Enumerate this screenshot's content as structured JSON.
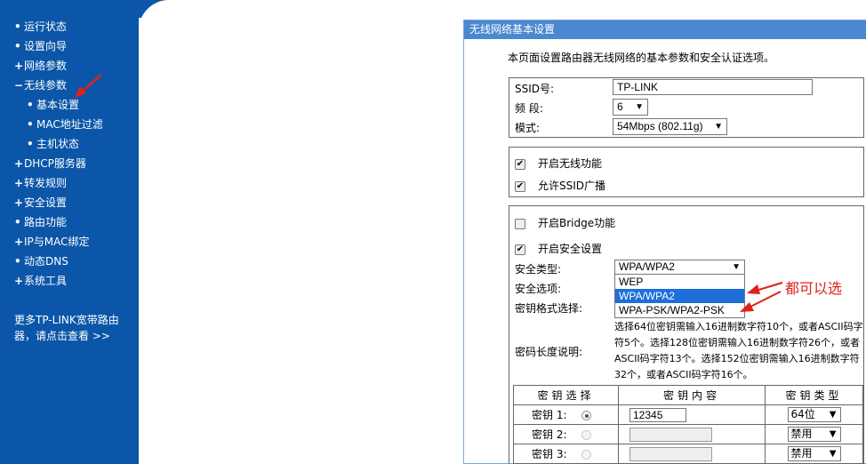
{
  "sidebar": {
    "items": [
      {
        "marker": "•",
        "label": "运行状态",
        "sub": false
      },
      {
        "marker": "•",
        "label": "设置向导",
        "sub": false
      },
      {
        "marker": "+",
        "label": "网络参数",
        "sub": false
      },
      {
        "marker": "−",
        "label": "无线参数",
        "sub": false
      },
      {
        "marker": "•",
        "label": "基本设置",
        "sub": true
      },
      {
        "marker": "•",
        "label": "MAC地址过滤",
        "sub": true
      },
      {
        "marker": "•",
        "label": "主机状态",
        "sub": true
      },
      {
        "marker": "+",
        "label": "DHCP服务器",
        "sub": false
      },
      {
        "marker": "+",
        "label": "转发规则",
        "sub": false
      },
      {
        "marker": "+",
        "label": "安全设置",
        "sub": false
      },
      {
        "marker": "•",
        "label": "路由功能",
        "sub": false
      },
      {
        "marker": "+",
        "label": "IP与MAC绑定",
        "sub": false
      },
      {
        "marker": "•",
        "label": "动态DNS",
        "sub": false
      },
      {
        "marker": "+",
        "label": "系统工具",
        "sub": false
      }
    ],
    "more_text": "更多TP-LINK宽带路由器，请点击查看 >>"
  },
  "panel": {
    "title": "无线网络基本设置",
    "intro": "本页面设置路由器无线网络的基本参数和安全认证选项。",
    "ssid_label": "SSID号:",
    "ssid_value": "TP-LINK",
    "channel_label": "频 段:",
    "channel_value": "6",
    "mode_label": "模式:",
    "mode_value": "54Mbps (802.11g)",
    "enable_wireless_label": "开启无线功能",
    "allow_ssid_broadcast_label": "允许SSID广播",
    "enable_bridge_label": "开启Bridge功能",
    "enable_security_label": "开启安全设置",
    "security_type_label": "安全类型:",
    "security_type_value": "WPA/WPA2",
    "security_options": [
      "WEP",
      "WPA/WPA2",
      "WPA-PSK/WPA2-PSK"
    ],
    "security_option_label": "安全选项:",
    "key_format_label": "密钥格式选择:",
    "pw_len_label": "密码长度说明:",
    "pw_len_desc": "选择64位密钥需输入16进制数字符10个，或者ASCII码字符5个。选择128位密钥需输入16进制数字符26个，或者ASCII码字符13个。选择152位密钥需输入16进制数字符32个，或者ASCII码字符16个。",
    "key_table": {
      "headers": [
        "密钥选择",
        "密钥内容",
        "密钥类型"
      ],
      "rows": [
        {
          "label": "密钥 1:",
          "selected": true,
          "content": "12345",
          "type": "64位"
        },
        {
          "label": "密钥 2:",
          "selected": false,
          "content": "",
          "type": "禁用"
        },
        {
          "label": "密钥 3:",
          "selected": false,
          "content": "",
          "type": "禁用"
        }
      ]
    }
  },
  "annotation": "都可以选",
  "colors": {
    "sidebar_bg": "#0b56a8",
    "title_bar": "#4a88d0",
    "annotation": "#e0201a",
    "selected_option": "#1e6fd9"
  }
}
